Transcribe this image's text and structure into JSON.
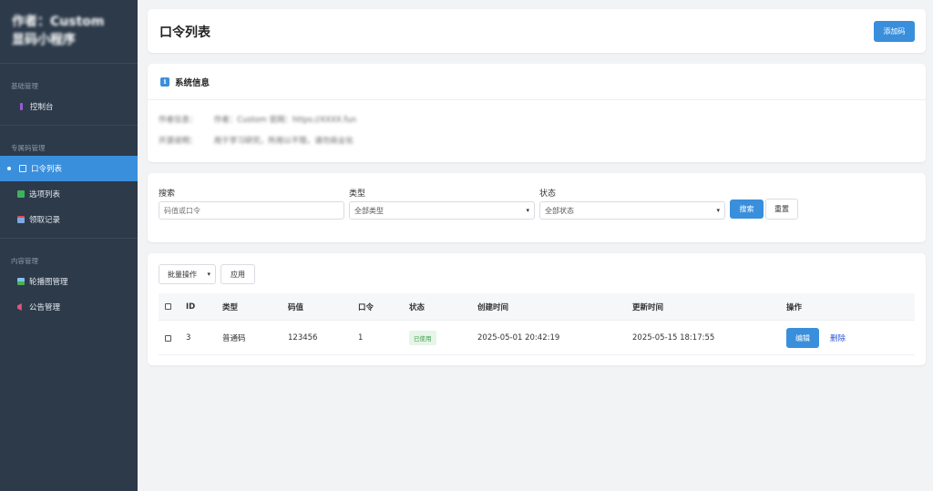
{
  "sidebar": {
    "brand_line1": "作者：Custom",
    "brand_line2": "显码小程序",
    "groups": [
      {
        "title": "基础管理",
        "items": [
          {
            "label": "控制台",
            "icon": "dashboard-icon"
          }
        ]
      },
      {
        "title": "专属码管理",
        "items": [
          {
            "label": "口令列表",
            "icon": "list-icon",
            "active": true
          },
          {
            "label": "选项列表",
            "icon": "check-icon"
          },
          {
            "label": "领取记录",
            "icon": "calendar-icon"
          }
        ]
      },
      {
        "title": "内容管理",
        "items": [
          {
            "label": "轮播图管理",
            "icon": "image-icon"
          },
          {
            "label": "公告管理",
            "icon": "megaphone-icon"
          }
        ]
      }
    ]
  },
  "header": {
    "title": "口令列表",
    "add_button": "添加码"
  },
  "info": {
    "title": "系统信息",
    "rows": [
      {
        "key": "作者信息：",
        "value": "作者：Custom 官网：https://XXXX.fun"
      },
      {
        "key": "开源说明：",
        "value": "用于学习研究，所用以不限，请勿商业化"
      }
    ]
  },
  "filters": {
    "search_label": "搜索",
    "search_placeholder": "码值或口令",
    "type_label": "类型",
    "type_value": "全部类型",
    "status_label": "状态",
    "status_value": "全部状态",
    "search_button": "搜索",
    "reset_button": "重置"
  },
  "table": {
    "batch_label": "批量操作",
    "apply_button": "应用",
    "columns": [
      "ID",
      "类型",
      "码值",
      "口令",
      "状态",
      "创建时间",
      "更新时间",
      "操作"
    ],
    "rows": [
      {
        "id": "3",
        "type": "普通码",
        "code": "123456",
        "command": "1",
        "status": "已使用",
        "created": "2025-05-01 20:42:19",
        "updated": "2025-05-15 18:17:55",
        "edit": "编辑",
        "delete": "删除"
      }
    ]
  },
  "colors": {
    "sidebar_bg": "#2c3a4a",
    "accent": "#3a8fdc",
    "status_used": "#3f9f4f"
  }
}
